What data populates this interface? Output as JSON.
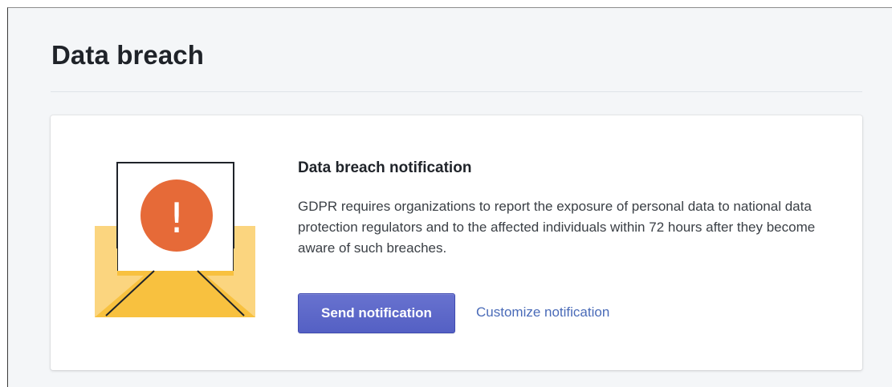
{
  "page": {
    "title": "Data breach"
  },
  "card": {
    "heading": "Data breach notification",
    "body": "GDPR requires organizations to report the exposure of personal data to national data protection regulators and to the affected individuals within 72 hours after they become aware of such breaches.",
    "primary_button_label": "Send notification",
    "secondary_link_label": "Customize notification",
    "illustration": {
      "icon": "envelope-alert-icon",
      "alert_glyph": "!"
    }
  },
  "colors": {
    "page_background": "#f4f6f8",
    "primary_button": "#5c66c9",
    "link": "#4a6bb8",
    "alert_circle": "#e66a38",
    "envelope_light": "#fbd57f",
    "envelope_dark": "#f8c13f"
  }
}
